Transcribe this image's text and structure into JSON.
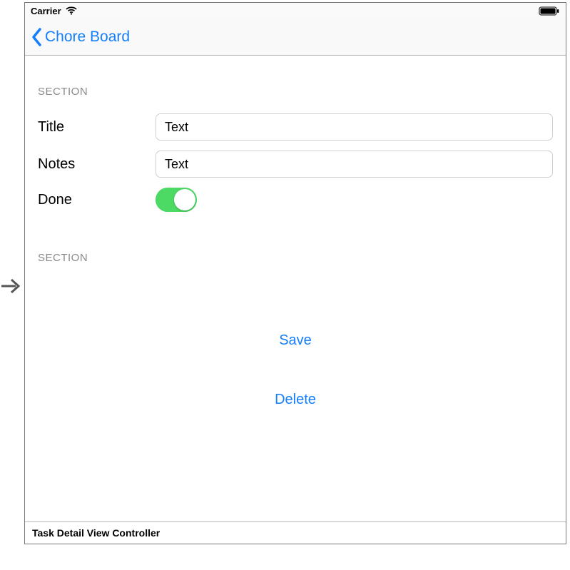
{
  "status_bar": {
    "carrier": "Carrier"
  },
  "nav_bar": {
    "back_label": "Chore Board"
  },
  "section1": {
    "header": "SECTION",
    "title_label": "Title",
    "title_value": "Text",
    "notes_label": "Notes",
    "notes_value": "Text",
    "done_label": "Done",
    "done_on": true
  },
  "section2": {
    "header": "SECTION",
    "save_label": "Save",
    "delete_label": "Delete"
  },
  "footer": {
    "scene_label": "Task Detail View Controller"
  }
}
